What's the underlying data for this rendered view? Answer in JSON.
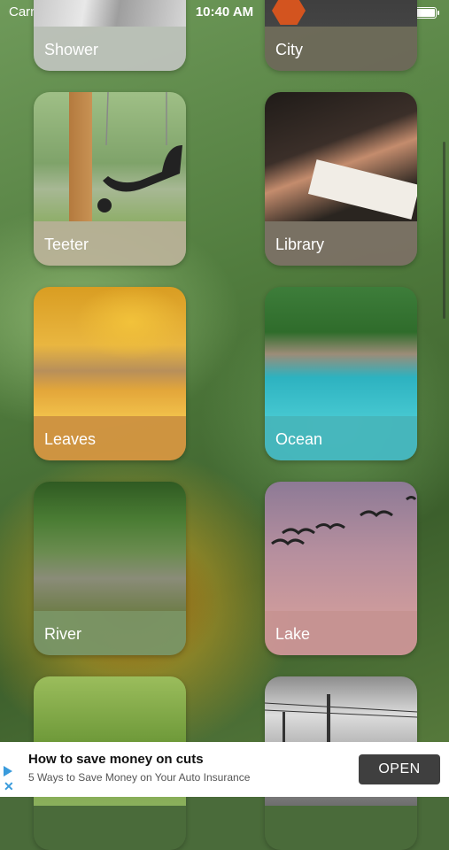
{
  "status_bar": {
    "carrier": "Carrier",
    "time": "10:40 AM"
  },
  "tiles": [
    {
      "label": "Shower"
    },
    {
      "label": "City"
    },
    {
      "label": "Teeter"
    },
    {
      "label": "Library"
    },
    {
      "label": "Leaves"
    },
    {
      "label": "Ocean"
    },
    {
      "label": "River"
    },
    {
      "label": "Lake"
    }
  ],
  "ad": {
    "title": "How to save money on cuts",
    "subtitle": "5 Ways to Save Money on Your Auto Insurance",
    "button": "OPEN"
  },
  "colors": {
    "leaves_bar": "#d69641",
    "ocean_bar": "#46b9c3",
    "lake_bar": "#cd9698",
    "ad_button": "#3f3f3f"
  },
  "icons": [
    "wifi-icon",
    "battery-icon",
    "ad-play-icon",
    "ad-close-icon"
  ]
}
